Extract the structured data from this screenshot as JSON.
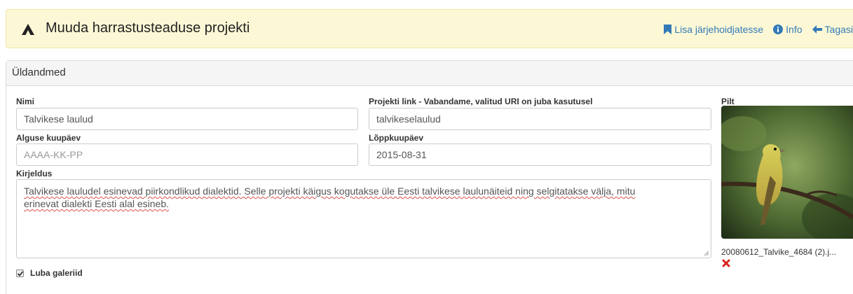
{
  "header": {
    "title": "Muuda harrastusteaduse projekti",
    "actions": [
      {
        "label": "Lisa järjehoidjatesse",
        "icon": "bookmark-icon"
      },
      {
        "label": "Info",
        "icon": "info-circle-icon"
      },
      {
        "label": "Tagasi",
        "icon": "arrow-left-icon"
      }
    ]
  },
  "panel": {
    "heading": "Üldandmed",
    "fields": {
      "name": {
        "label": "Nimi",
        "value": "Talvikese laulud"
      },
      "link": {
        "label": "Projekti link - Vabandame, valitud URI on juba kasutusel",
        "value": "talvikeselaulud"
      },
      "start_date": {
        "label": "Alguse kuupäev",
        "value": "",
        "placeholder": "AAAA-KK-PP"
      },
      "end_date": {
        "label": "Lõppkuupäev",
        "value": "2015-08-31"
      },
      "description": {
        "label": "Kirjeldus",
        "line1": "Talvikese lauludel esinevad piirkondlikud dialektid. Selle projekti käigus kogutakse üle Eesti talvikese laulunäiteid ning selgitatakse välja, mitu",
        "line2": "erinevat dialekti Eesti alal esineb."
      }
    },
    "gallery_checkbox": {
      "label": "Luba galeriid",
      "checked": true
    },
    "image": {
      "label": "Pilt",
      "filename": "20080612_Talvike_4684 (2).j..."
    }
  },
  "colors": {
    "accent": "#337ab7",
    "titlebar_bg": "#fcf8d6",
    "remove": "#d9231d"
  }
}
